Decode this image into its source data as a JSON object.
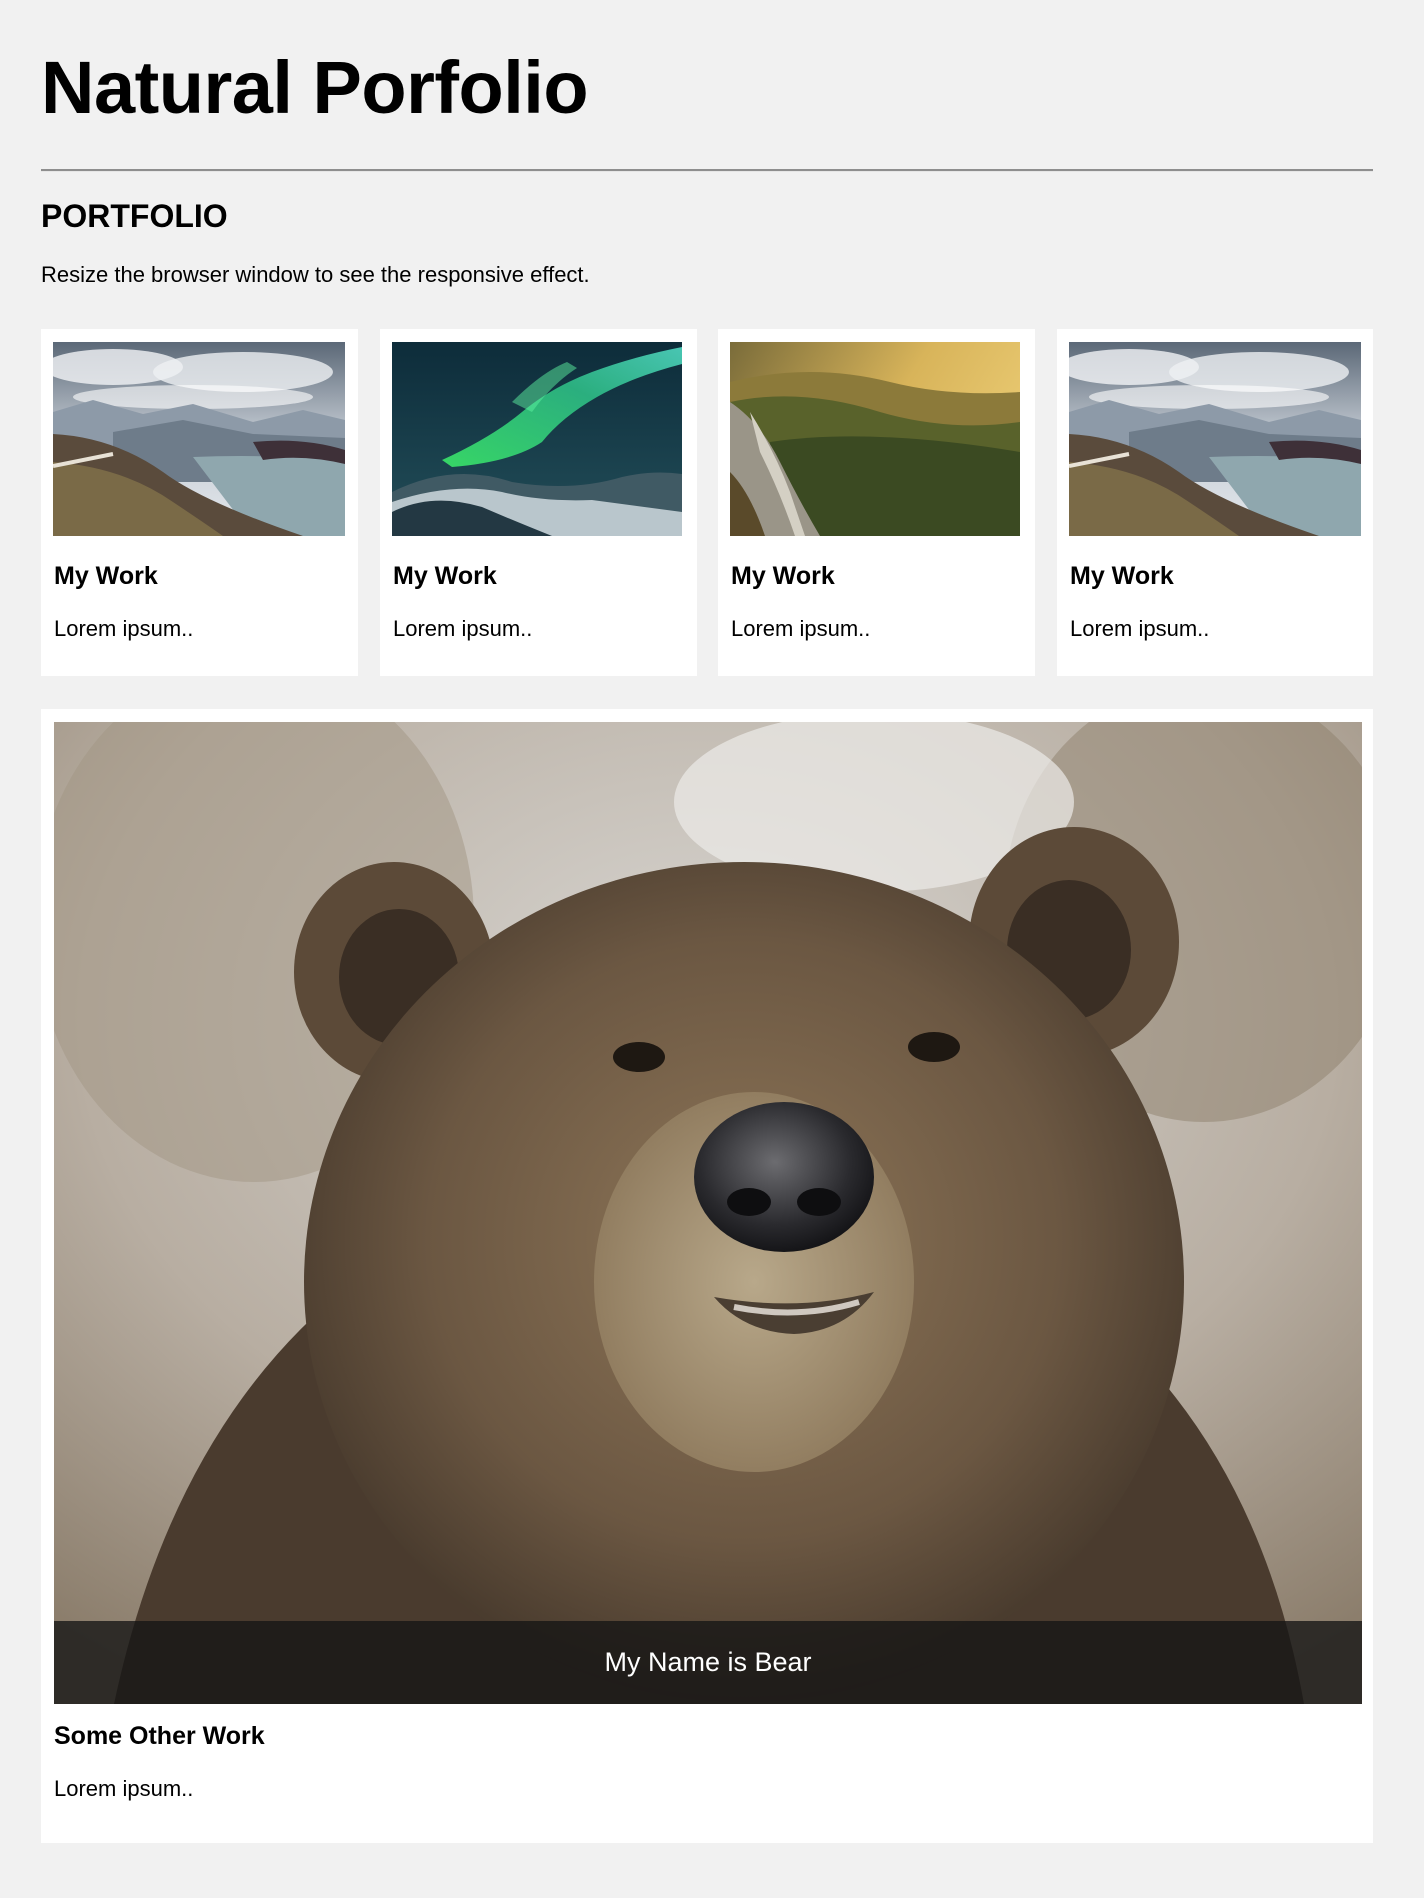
{
  "header": {
    "title": "Natural Porfolio"
  },
  "portfolio": {
    "heading": "PORTFOLIO",
    "intro": "Resize the browser window to see the responsive effect.",
    "cards": [
      {
        "title": "My Work",
        "text": "Lorem ipsum..",
        "image": "mountain-fjord-photo"
      },
      {
        "title": "My Work",
        "text": "Lorem ipsum..",
        "image": "aurora-photo"
      },
      {
        "title": "My Work",
        "text": "Lorem ipsum..",
        "image": "forest-valley-photo"
      },
      {
        "title": "My Work",
        "text": "Lorem ipsum..",
        "image": "mountain-fjord-photo"
      }
    ],
    "feature": {
      "caption": "My Name is Bear",
      "title": "Some Other Work",
      "text": "Lorem ipsum..",
      "image": "bear-photo"
    }
  },
  "colors": {
    "page_background": "#f1f1f1",
    "card_background": "#ffffff",
    "caption_background": "#141414"
  }
}
